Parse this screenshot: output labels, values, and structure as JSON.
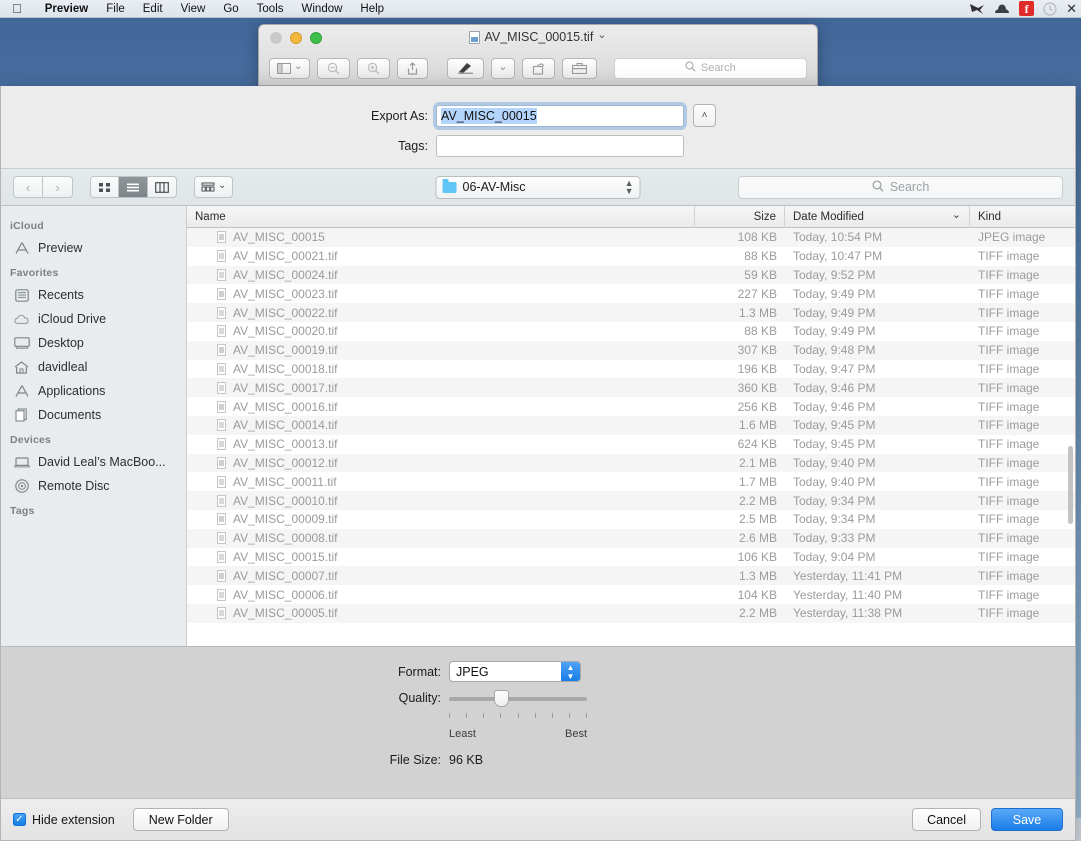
{
  "menubar": {
    "apple": "apple-logo",
    "items": [
      {
        "label": "Preview",
        "bold": true
      },
      {
        "label": "File",
        "bold": false
      },
      {
        "label": "Edit",
        "bold": false
      },
      {
        "label": "View",
        "bold": false
      },
      {
        "label": "Go",
        "bold": false
      },
      {
        "label": "Tools",
        "bold": false
      },
      {
        "label": "Window",
        "bold": false
      },
      {
        "label": "Help",
        "bold": false
      }
    ],
    "status_icons": [
      {
        "name": "hummingbird-icon",
        "glyph": "➤"
      },
      {
        "name": "bowler-hat-icon",
        "glyph": "◔"
      },
      {
        "name": "facebook-icon",
        "glyph": "f"
      },
      {
        "name": "time-machine-icon",
        "glyph": "◷"
      },
      {
        "name": "notification-center-icon",
        "glyph": "≡"
      }
    ]
  },
  "preview_window": {
    "title": "AV_MISC_00015.tif",
    "title_chevron": "⌄",
    "toolbar": {
      "sidebar_label": "▤",
      "chevron": "⌄",
      "zoom_out": "⊖",
      "zoom_in": "⊕",
      "share": "⇧",
      "markup": "✎",
      "markup_chevron": "⌄",
      "rotate": "↻",
      "toolbox": "⌘",
      "search_placeholder": "Search",
      "search_icon": "⌕"
    }
  },
  "sheet": {
    "export_as_label": "Export As:",
    "export_as_value": "AV_MISC_00015",
    "tags_label": "Tags:",
    "tags_value": "",
    "disclosure_glyph": "˄"
  },
  "navbar": {
    "back_glyph": "‹",
    "forward_glyph": "›",
    "view_icon_glyph": "∷",
    "view_list_glyph": "≡",
    "view_column_glyph": "⫼",
    "arrange_glyph": "☷",
    "arrange_chevron": "⌄",
    "location": "06-AV-Misc",
    "location_stepper": "⌃⌄",
    "search_placeholder": "Search",
    "search_icon": "⌕"
  },
  "sidebar": {
    "sections": [
      {
        "header": "iCloud",
        "items": [
          {
            "label": "Preview",
            "icon": "preview-app-icon",
            "glyph": "⨉"
          }
        ]
      },
      {
        "header": "Favorites",
        "items": [
          {
            "label": "Recents",
            "icon": "recents-clock-icon",
            "glyph": "▤"
          },
          {
            "label": "iCloud Drive",
            "icon": "cloud-icon",
            "glyph": "☁"
          },
          {
            "label": "Desktop",
            "icon": "desktop-monitor-icon",
            "glyph": "▭"
          },
          {
            "label": "davidleal",
            "icon": "home-house-icon",
            "glyph": "⌂"
          },
          {
            "label": "Applications",
            "icon": "applications-icon",
            "glyph": "⨉"
          },
          {
            "label": "Documents",
            "icon": "documents-folder-icon",
            "glyph": "❐"
          }
        ]
      },
      {
        "header": "Devices",
        "items": [
          {
            "label": "David Leal’s MacBoo...",
            "icon": "laptop-icon",
            "glyph": "▭"
          },
          {
            "label": "Remote Disc",
            "icon": "disc-icon",
            "glyph": "◎"
          }
        ]
      },
      {
        "header": "Tags",
        "items": []
      }
    ]
  },
  "filelist": {
    "columns": [
      {
        "key": "name",
        "label": "Name"
      },
      {
        "key": "size",
        "label": "Size"
      },
      {
        "key": "date",
        "label": "Date Modified",
        "sorted": true,
        "sort_glyph": "⌄"
      },
      {
        "key": "kind",
        "label": "Kind"
      }
    ],
    "rows": [
      {
        "name": "AV_MISC_00015",
        "size": "108 KB",
        "date": "Today, 10:54 PM",
        "kind": "JPEG image"
      },
      {
        "name": "AV_MISC_00021.tif",
        "size": "88 KB",
        "date": "Today, 10:47 PM",
        "kind": "TIFF image"
      },
      {
        "name": "AV_MISC_00024.tif",
        "size": "59 KB",
        "date": "Today, 9:52 PM",
        "kind": "TIFF image"
      },
      {
        "name": "AV_MISC_00023.tif",
        "size": "227 KB",
        "date": "Today, 9:49 PM",
        "kind": "TIFF image"
      },
      {
        "name": "AV_MISC_00022.tif",
        "size": "1.3 MB",
        "date": "Today, 9:49 PM",
        "kind": "TIFF image"
      },
      {
        "name": "AV_MISC_00020.tif",
        "size": "88 KB",
        "date": "Today, 9:49 PM",
        "kind": "TIFF image"
      },
      {
        "name": "AV_MISC_00019.tif",
        "size": "307 KB",
        "date": "Today, 9:48 PM",
        "kind": "TIFF image"
      },
      {
        "name": "AV_MISC_00018.tif",
        "size": "196 KB",
        "date": "Today, 9:47 PM",
        "kind": "TIFF image"
      },
      {
        "name": "AV_MISC_00017.tif",
        "size": "360 KB",
        "date": "Today, 9:46 PM",
        "kind": "TIFF image"
      },
      {
        "name": "AV_MISC_00016.tif",
        "size": "256 KB",
        "date": "Today, 9:46 PM",
        "kind": "TIFF image"
      },
      {
        "name": "AV_MISC_00014.tif",
        "size": "1.6 MB",
        "date": "Today, 9:45 PM",
        "kind": "TIFF image"
      },
      {
        "name": "AV_MISC_00013.tif",
        "size": "624 KB",
        "date": "Today, 9:45 PM",
        "kind": "TIFF image"
      },
      {
        "name": "AV_MISC_00012.tif",
        "size": "2.1 MB",
        "date": "Today, 9:40 PM",
        "kind": "TIFF image"
      },
      {
        "name": "AV_MISC_00011.tif",
        "size": "1.7 MB",
        "date": "Today, 9:40 PM",
        "kind": "TIFF image"
      },
      {
        "name": "AV_MISC_00010.tif",
        "size": "2.2 MB",
        "date": "Today, 9:34 PM",
        "kind": "TIFF image"
      },
      {
        "name": "AV_MISC_00009.tif",
        "size": "2.5 MB",
        "date": "Today, 9:34 PM",
        "kind": "TIFF image"
      },
      {
        "name": "AV_MISC_00008.tif",
        "size": "2.6 MB",
        "date": "Today, 9:33 PM",
        "kind": "TIFF image"
      },
      {
        "name": "AV_MISC_00015.tif",
        "size": "106 KB",
        "date": "Today, 9:04 PM",
        "kind": "TIFF image"
      },
      {
        "name": "AV_MISC_00007.tif",
        "size": "1.3 MB",
        "date": "Yesterday, 11:41 PM",
        "kind": "TIFF image"
      },
      {
        "name": "AV_MISC_00006.tif",
        "size": "104 KB",
        "date": "Yesterday, 11:40 PM",
        "kind": "TIFF image"
      },
      {
        "name": "AV_MISC_00005.tif",
        "size": "2.2 MB",
        "date": "Yesterday, 11:38 PM",
        "kind": "TIFF image"
      },
      {
        "name": "",
        "size": "",
        "date": "",
        "kind": ""
      }
    ]
  },
  "format_panel": {
    "format_label": "Format:",
    "format_value": "JPEG",
    "quality_label": "Quality:",
    "quality_least": "Least",
    "quality_best": "Best",
    "quality_position_percent": 38,
    "filesize_label": "File Size:",
    "filesize_value": "96 KB"
  },
  "bottom_bar": {
    "hide_extension_label": "Hide extension",
    "hide_extension_checked": true,
    "check_glyph": "✓",
    "new_folder_label": "New Folder",
    "cancel_label": "Cancel",
    "save_label": "Save"
  },
  "colors": {
    "accent_blue": "#1a7ce9",
    "selection_blue": "#b4d5fb",
    "facebook_red": "#e02b2b",
    "folder_blue": "#5fc6f5"
  }
}
